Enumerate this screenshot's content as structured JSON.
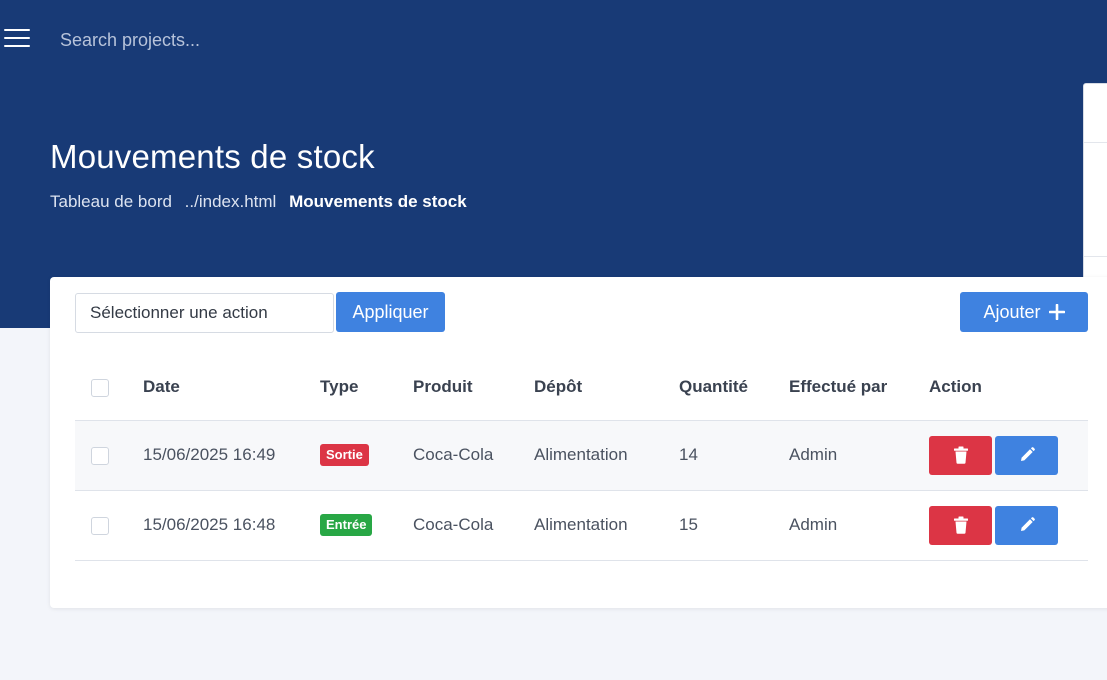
{
  "topbar": {
    "search_placeholder": "Search projects..."
  },
  "header": {
    "title": "Mouvements de stock",
    "breadcrumb": {
      "home": "Tableau de bord",
      "link": "../index.html",
      "current": "Mouvements de stock"
    }
  },
  "toolbar": {
    "select_placeholder": "Sélectionner une action",
    "apply_label": "Appliquer",
    "add_label": "Ajouter"
  },
  "table": {
    "columns": [
      "Date",
      "Type",
      "Produit",
      "Dépôt",
      "Quantité",
      "Effectué par",
      "Action"
    ],
    "rows": [
      {
        "date": "15/06/2025 16:49",
        "type": "Sortie",
        "type_color": "#dc3545",
        "product": "Coca-Cola",
        "depot": "Alimentation",
        "quantity": "14",
        "by": "Admin"
      },
      {
        "date": "15/06/2025 16:48",
        "type": "Entrée",
        "type_color": "#28a745",
        "product": "Coca-Cola",
        "depot": "Alimentation",
        "quantity": "15",
        "by": "Admin"
      }
    ]
  },
  "icons": {
    "menu": "hamburger-icon",
    "add": "plus-icon",
    "delete": "trash-icon",
    "edit": "pencil-icon"
  },
  "colors": {
    "header_bg": "#183a76",
    "primary": "#3f82e0",
    "danger": "#dc3545",
    "success": "#28a745",
    "page_bg": "#f3f5fa"
  }
}
